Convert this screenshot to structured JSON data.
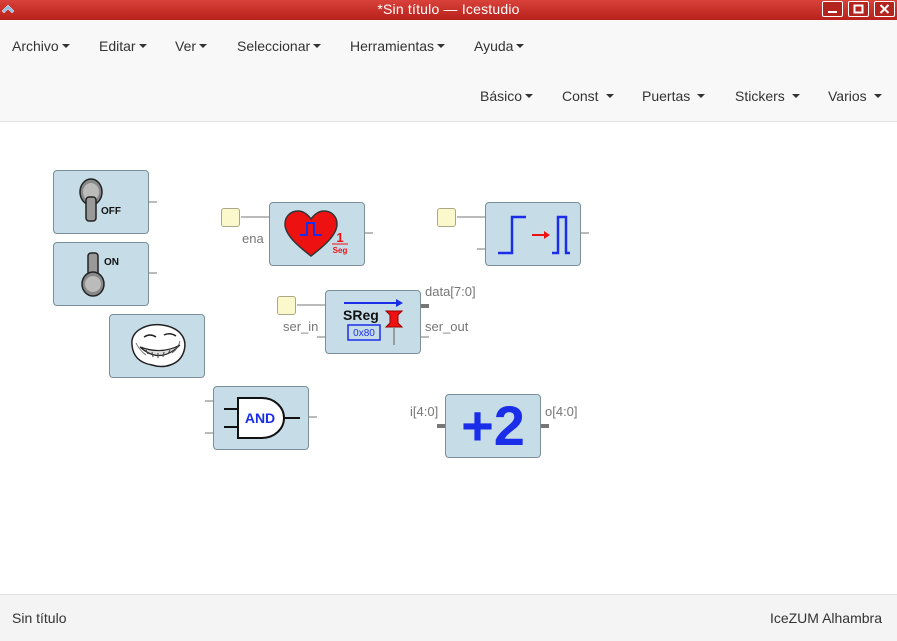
{
  "window": {
    "title": "*Sin título — Icestudio"
  },
  "menus": {
    "main": [
      "Archivo",
      "Editar",
      "Ver",
      "Seleccionar",
      "Herramientas",
      "Ayuda"
    ],
    "toolbox": [
      "Básico",
      "Const",
      "Puertas",
      "Stickers",
      "Varios"
    ]
  },
  "blocks": {
    "switch_off": {
      "label": "OFF"
    },
    "switch_on": {
      "label": "ON"
    },
    "heart": {
      "input_label": "ena",
      "value": "1",
      "unit": "Seg"
    },
    "sreg": {
      "title": "SReg",
      "init": "0x80",
      "input_label": "ser_in",
      "output_data": "data[7:0]",
      "output_serial": "ser_out"
    },
    "and_gate": {
      "label": "AND"
    },
    "adder": {
      "label": "+2",
      "input": "i[4:0]",
      "output": "o[4:0]"
    }
  },
  "status": {
    "left": "Sin título",
    "right": "IceZUM Alhambra"
  },
  "colors": {
    "titlebar": "#c9312a",
    "block_bg": "#c6dde8",
    "wire": "#777777",
    "accent_blue": "#0000ee",
    "accent_red": "#ee0000"
  }
}
